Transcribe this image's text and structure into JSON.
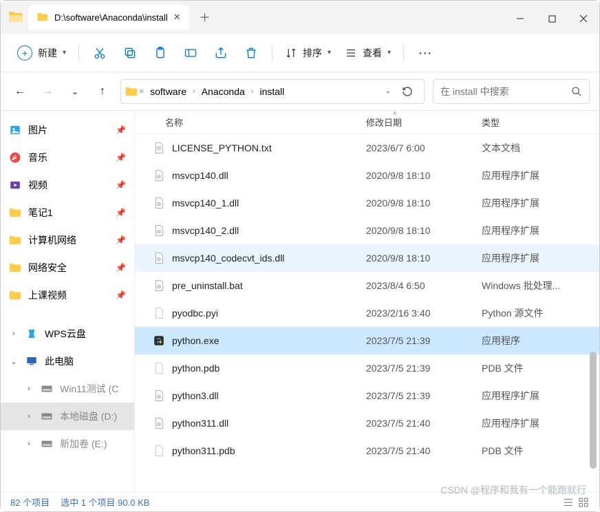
{
  "window": {
    "tab_title": "D:\\software\\Anaconda\\install"
  },
  "toolbar": {
    "new_label": "新建",
    "sort_label": "排序",
    "view_label": "查看"
  },
  "breadcrumb": {
    "segs": [
      "software",
      "Anaconda",
      "install"
    ]
  },
  "search": {
    "placeholder": "在 install 中搜索"
  },
  "sidebar": {
    "quick": [
      {
        "label": "图片",
        "icon": "pictures"
      },
      {
        "label": "音乐",
        "icon": "music"
      },
      {
        "label": "视频",
        "icon": "video"
      },
      {
        "label": "笔记1",
        "icon": "folder"
      },
      {
        "label": "计算机网络",
        "icon": "folder"
      },
      {
        "label": "网络安全",
        "icon": "folder"
      },
      {
        "label": "上课视频",
        "icon": "folder"
      }
    ],
    "wps_label": "WPS云盘",
    "thispc_label": "此电脑",
    "drives": [
      {
        "label": "Win11测试 (C"
      },
      {
        "label": "本地磁盘 (D:)"
      },
      {
        "label": "新加卷 (E:)"
      }
    ]
  },
  "columns": {
    "name": "名称",
    "date": "修改日期",
    "type": "类型"
  },
  "files": [
    {
      "name": "LICENSE_PYTHON.txt",
      "date": "2023/6/7 6:00",
      "type": "文本文档",
      "icon": "txt",
      "state": ""
    },
    {
      "name": "msvcp140.dll",
      "date": "2020/9/8 18:10",
      "type": "应用程序扩展",
      "icon": "dll",
      "state": ""
    },
    {
      "name": "msvcp140_1.dll",
      "date": "2020/9/8 18:10",
      "type": "应用程序扩展",
      "icon": "dll",
      "state": ""
    },
    {
      "name": "msvcp140_2.dll",
      "date": "2020/9/8 18:10",
      "type": "应用程序扩展",
      "icon": "dll",
      "state": ""
    },
    {
      "name": "msvcp140_codecvt_ids.dll",
      "date": "2020/9/8 18:10",
      "type": "应用程序扩展",
      "icon": "dll",
      "state": "hover"
    },
    {
      "name": "pre_uninstall.bat",
      "date": "2023/8/4 6:50",
      "type": "Windows 批处理...",
      "icon": "bat",
      "state": ""
    },
    {
      "name": "pyodbc.pyi",
      "date": "2023/2/16 3:40",
      "type": "Python 源文件",
      "icon": "file",
      "state": ""
    },
    {
      "name": "python.exe",
      "date": "2023/7/5 21:39",
      "type": "应用程序",
      "icon": "py",
      "state": "selected"
    },
    {
      "name": "python.pdb",
      "date": "2023/7/5 21:39",
      "type": "PDB 文件",
      "icon": "file",
      "state": ""
    },
    {
      "name": "python3.dll",
      "date": "2023/7/5 21:39",
      "type": "应用程序扩展",
      "icon": "dll",
      "state": ""
    },
    {
      "name": "python311.dll",
      "date": "2023/7/5 21:40",
      "type": "应用程序扩展",
      "icon": "dll",
      "state": ""
    },
    {
      "name": "python311.pdb",
      "date": "2023/7/5 21:40",
      "type": "PDB 文件",
      "icon": "file",
      "state": ""
    }
  ],
  "status": {
    "items": "82 个项目",
    "selected": "选中 1 个项目",
    "size": "90.0 KB"
  },
  "watermark": "CSDN @程序和我有一个能跑就行"
}
